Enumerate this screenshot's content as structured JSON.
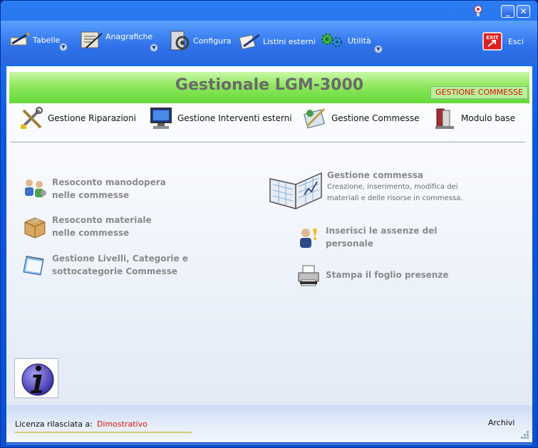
{
  "titlebar": {
    "minimize_label": "_",
    "close_label": "✕"
  },
  "toolbar": {
    "items": [
      {
        "label": "Tabelle",
        "icon": "pen-table-icon"
      },
      {
        "label": "Anagrafiche",
        "icon": "registry-icon"
      },
      {
        "label": "Configura",
        "icon": "configure-icon"
      },
      {
        "label": "Listini esterni",
        "icon": "price-list-icon"
      },
      {
        "label": "Utilità",
        "icon": "gears-icon"
      }
    ],
    "exit_label": "Esci",
    "exit_icon_text": "EXIT"
  },
  "banner": {
    "title": "Gestionale LGM-3000",
    "tag": "GESTIONE COMMESSE"
  },
  "modules": [
    {
      "label": "Gestione Riparazioni",
      "icon": "tools-icon"
    },
    {
      "label": "Gestione Interventi esterni",
      "icon": "computer-icon"
    },
    {
      "label": "Gestione Commesse",
      "icon": "commesse-icon"
    },
    {
      "label": "Modulo base",
      "icon": "books-icon"
    }
  ],
  "left_items": [
    {
      "line1": "Resoconto manodopera",
      "line2": "nelle commesse",
      "icon": "workers-icon"
    },
    {
      "line1": "Resoconto materiale",
      "line2": "nelle commesse",
      "icon": "box-icon"
    },
    {
      "line1": "Gestione Livelli, Categorie e",
      "line2": "sottocategorie Commesse",
      "icon": "notepad-icon"
    }
  ],
  "right_main": {
    "title": "Gestione commessa",
    "desc1": "Creazione, inserimento, modifica dei",
    "desc2": "materiali e delle  risorse in commessa."
  },
  "right_items": [
    {
      "line1": "Inserisci le assenze del",
      "line2": "personale",
      "icon": "absence-icon"
    },
    {
      "line1": "Stampa il foglio presenze",
      "line2": "",
      "icon": "printer-icon"
    }
  ],
  "status": {
    "license_label": "Licenza rilasciata a:",
    "license_value": "Dimostrativo",
    "archivi_label": "Archivi"
  },
  "colors": {
    "accent": "#0b5ae0",
    "banner_green": "#64d93a",
    "license_red": "#e01010"
  }
}
